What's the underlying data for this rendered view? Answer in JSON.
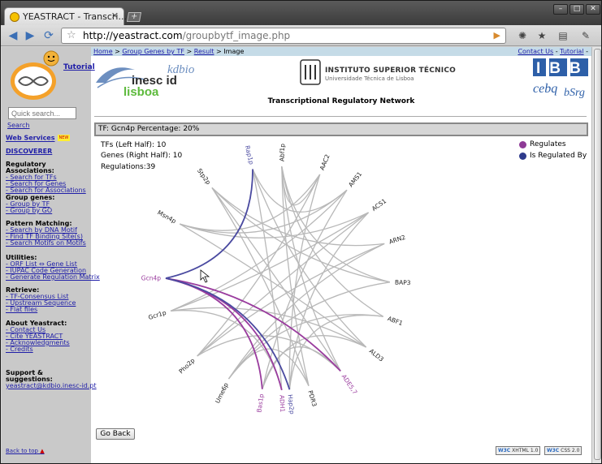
{
  "browser": {
    "tab_title": "YEASTRACT - Transcri...",
    "tab_close": "✕",
    "new_tab": "+",
    "url_host": "http://yeastract.com",
    "url_path": "/groupbytf_image.php"
  },
  "sidebar": {
    "tutorial": "Tutorial",
    "search_placeholder": "Quick search...",
    "search_link": "Search",
    "web_services": "Web Services",
    "new_badge": "NEW",
    "discoverer": "DISCOVERER",
    "sections": [
      {
        "title": "Regulatory Associations:",
        "items": [
          "- Search for TFs",
          "- Search for Genes",
          "- Search for Associations"
        ]
      },
      {
        "title": "Group genes:",
        "items": [
          "- Group by TF",
          "- Group by GO"
        ]
      },
      {
        "title": "Pattern Matching:",
        "items": [
          "- Search by DNA Motif",
          "- Find TF Binding Site(s)",
          "- Search Motifs on Motifs"
        ]
      },
      {
        "title": "Utilities:",
        "items": [
          "- ORF List ⇔ Gene List",
          "- IUPAC Code Generation",
          "- Generate Regulation Matrix"
        ]
      },
      {
        "title": "Retrieve:",
        "items": [
          "- TF-Consensus List",
          "- Upstream Sequence",
          "- Flat files"
        ]
      },
      {
        "title": "About Yeastract:",
        "items": [
          "- Contact Us",
          "- Cite YEASTRACT",
          "- Acknowledgments",
          "- Credits"
        ]
      }
    ],
    "support_title": "Support & suggestions:",
    "support_email": "yeastract@kdbio.inesc-id.pt",
    "back_to_top": "Back to top"
  },
  "breadcrumb": {
    "home": "Home",
    "sep": " > ",
    "group": "Group Genes by TF",
    "result": "Result",
    "current": "Image"
  },
  "toplinks": {
    "contact": "Contact Us",
    "dash": " - ",
    "tutorial": "Tutorial",
    "trail": " -"
  },
  "logos": {
    "inesc": "inesc id",
    "lisboa": "lisboa",
    "kdbio": "kdbio",
    "ist_title": "INSTITUTO SUPERIOR TÉCNICO",
    "ist_subtitle": "Universidade Técnica de Lisboa",
    "ibb": "IBB",
    "cebq": "cebq",
    "bsrg": "bSrg"
  },
  "page": {
    "title": "Transcriptional Regulatory Network",
    "tf_bar": "TF: Gcn4p Percentage: 20%",
    "tfs_left": "TFs (Left Half): 10",
    "genes_right": "Genes (Right Half): 10",
    "regulations": "Regulations:39",
    "go_back": "Go Back",
    "w3c_xhtml": "XHTML 1.0",
    "w3c_css": "CSS 2.0"
  },
  "legend": [
    {
      "label": "Regulates",
      "color": "#8e3a96"
    },
    {
      "label": "Is Regulated By",
      "color": "#2e3b8c"
    }
  ],
  "colors": {
    "regulates": "#9a3c9e",
    "regulated_by": "#4a4aa0",
    "other_edge": "#b8b8b8",
    "label_highlight": "#9a3c9e",
    "link": "#1f1ea8",
    "sidebar_bg": "#c9c9c9",
    "crumb_bg": "#c5dbe7"
  },
  "network": {
    "nodes": [
      {
        "label": "Gcn4p",
        "side": "left"
      },
      {
        "label": "Msn4p",
        "side": "left"
      },
      {
        "label": "Stp2p",
        "side": "left"
      },
      {
        "label": "Rap1p",
        "side": "left"
      },
      {
        "label": "Abf1p",
        "side": "left"
      },
      {
        "label": "Gcr1p",
        "side": "left"
      },
      {
        "label": "Pho2p",
        "side": "left"
      },
      {
        "label": "Ume6p",
        "side": "left"
      },
      {
        "label": "Bas1p",
        "side": "left"
      },
      {
        "label": "Hap2p",
        "side": "left"
      },
      {
        "label": "AAC2",
        "side": "right"
      },
      {
        "label": "AMS1",
        "side": "right"
      },
      {
        "label": "ACS1",
        "side": "right"
      },
      {
        "label": "ARN2",
        "side": "right"
      },
      {
        "label": "BAP3",
        "side": "right"
      },
      {
        "label": "ABF1",
        "side": "right"
      },
      {
        "label": "ALD3",
        "side": "right"
      },
      {
        "label": "ADE5,7",
        "side": "right"
      },
      {
        "label": "PDR3",
        "side": "right"
      },
      {
        "label": "ADH1",
        "side": "right"
      }
    ],
    "edges": [
      [
        "Gcn4p",
        "ADE5,7",
        "reg"
      ],
      [
        "Gcn4p",
        "ADH1",
        "reg"
      ],
      [
        "Gcn4p",
        "Bas1p",
        "reg"
      ],
      [
        "Rap1p",
        "Gcn4p",
        "by"
      ],
      [
        "Hap2p",
        "Gcn4p",
        "by"
      ],
      [
        "Msn4p",
        "ALD3",
        "o"
      ],
      [
        "Msn4p",
        "ACS1",
        "o"
      ],
      [
        "Stp2p",
        "BAP3",
        "o"
      ],
      [
        "Stp2p",
        "ARN2",
        "o"
      ],
      [
        "Rap1p",
        "AMS1",
        "o"
      ],
      [
        "Rap1p",
        "ADH1",
        "o"
      ],
      [
        "Abf1p",
        "AAC2",
        "o"
      ],
      [
        "Abf1p",
        "ABF1",
        "o"
      ],
      [
        "Abf1p",
        "BAP3",
        "o"
      ],
      [
        "Gcr1p",
        "ADH1",
        "o"
      ],
      [
        "Gcr1p",
        "ALD3",
        "o"
      ],
      [
        "Gcr1p",
        "ACS1",
        "o"
      ],
      [
        "Pho2p",
        "ADE5,7",
        "o"
      ],
      [
        "Pho2p",
        "ACS1",
        "o"
      ],
      [
        "Ume6p",
        "ARN2",
        "o"
      ],
      [
        "Ume6p",
        "PDR3",
        "o"
      ],
      [
        "Ume6p",
        "ABF1",
        "o"
      ],
      [
        "Bas1p",
        "AMS1",
        "o"
      ],
      [
        "Bas1p",
        "ADE5,7",
        "o"
      ],
      [
        "Hap2p",
        "ACS1",
        "o"
      ],
      [
        "Hap2p",
        "AAC2",
        "o"
      ],
      [
        "Abf1p",
        "ADE5,7",
        "o"
      ],
      [
        "Stp2p",
        "PDR3",
        "o"
      ],
      [
        "Msn4p",
        "AAC2",
        "o"
      ],
      [
        "Rap1p",
        "ALD3",
        "o"
      ],
      [
        "Gcr1p",
        "AMS1",
        "o"
      ],
      [
        "Pho2p",
        "ARN2",
        "o"
      ],
      [
        "Ume6p",
        "BAP3",
        "o"
      ],
      [
        "Bas1p",
        "ALD3",
        "o"
      ],
      [
        "Hap2p",
        "ABF1",
        "o"
      ],
      [
        "Abf1p",
        "PDR3",
        "o"
      ],
      [
        "Stp2p",
        "ADE5,7",
        "o"
      ],
      [
        "Msn4p",
        "AMS1",
        "o"
      ],
      [
        "Pho2p",
        "AAC2",
        "o"
      ]
    ]
  }
}
